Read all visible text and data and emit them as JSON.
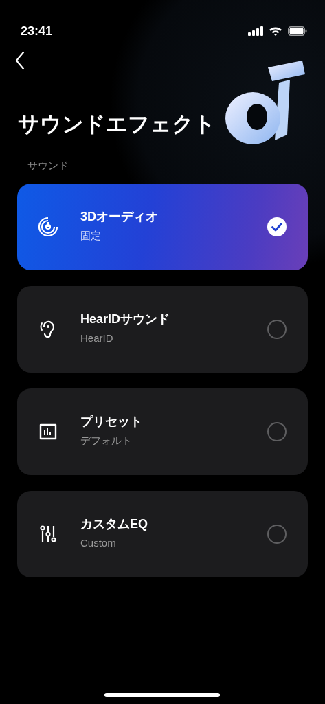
{
  "status_bar": {
    "time": "23:41"
  },
  "title": "サウンドエフェクト",
  "section_label": "サウンド",
  "options": [
    {
      "kind": "spatial",
      "title": "3Dオーディオ",
      "subtitle": "固定",
      "selected": true
    },
    {
      "kind": "ear",
      "title": "HearIDサウンド",
      "subtitle": "HearID",
      "selected": false
    },
    {
      "kind": "preset",
      "title": "プリセット",
      "subtitle": "デフォルト",
      "selected": false
    },
    {
      "kind": "eq",
      "title": "カスタムEQ",
      "subtitle": "Custom",
      "selected": false
    }
  ]
}
